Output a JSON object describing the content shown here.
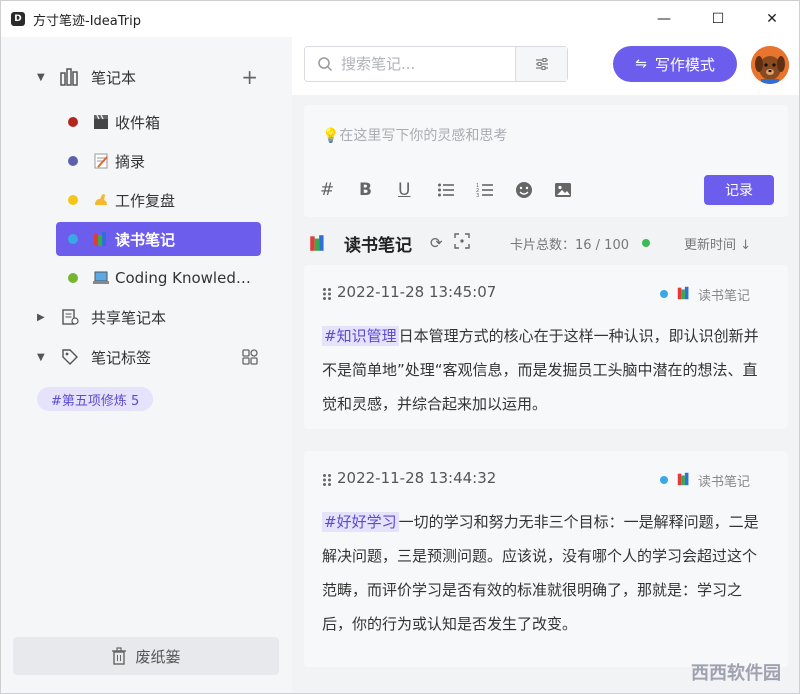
{
  "window": {
    "title": "方寸笔迹-IdeaTrip",
    "logo_letter": "D",
    "minimize": "—",
    "maximize": "☐",
    "close": "✕"
  },
  "sidebar": {
    "notebooks_label": "笔记本",
    "add_icon": "+",
    "notebooks": [
      {
        "label": "收件箱",
        "color": "#b3261e",
        "emoji": "clapperboard-icon"
      },
      {
        "label": "摘录",
        "color": "#5a62ae",
        "emoji": "memo-icon"
      },
      {
        "label": "工作复盘",
        "color": "#f5c518",
        "emoji": "flexed-arm-icon"
      },
      {
        "label": "读书笔记",
        "color": "#3ba7e6",
        "emoji": "books-icon",
        "active": true
      },
      {
        "label": "Coding Knowledge",
        "color": "#74b72e",
        "emoji": "laptop-icon"
      }
    ],
    "shared_label": "共享笔记本",
    "tags_label": "笔记标签",
    "tag_chip": "#第五项修炼  5",
    "trash_label": "废纸篓"
  },
  "header": {
    "search_placeholder": "搜索笔记...",
    "write_mode_label": "写作模式"
  },
  "editor": {
    "placeholder": "💡在这里写下你的灵感和思考",
    "record_label": "记录"
  },
  "notebook_header": {
    "title": "读书笔记",
    "card_count": "卡片总数：16 / 100",
    "sort_label": "更新时间 ↓"
  },
  "cards": [
    {
      "time": "2022-11-28 13:45:07",
      "notebook": "读书笔记",
      "tag": "#知识管理",
      "text": "日本管理方式的核心在于这样一种认识，即认识创新并不是简单地”处理“客观信息，而是发掘员工头脑中潜在的想法、直觉和灵感，并综合起来加以运用。"
    },
    {
      "time": "2022-11-28 13:44:32",
      "notebook": "读书笔记",
      "tag": "#好好学习",
      "text": "一切的学习和努力无非三个目标：一是解释问题，二是解决问题，三是预测问题。应该说，没有哪个人的学习会超过这个范畴，而评价学习是否有效的标准就很明确了，那就是：学习之后，你的行为或认知是否发生了改变。"
    }
  ],
  "watermark": "西西软件园",
  "colors": {
    "accent": "#6c5dec",
    "tag_bg": "#e6e2fb",
    "sidebar_bg": "#f5f6f8"
  }
}
